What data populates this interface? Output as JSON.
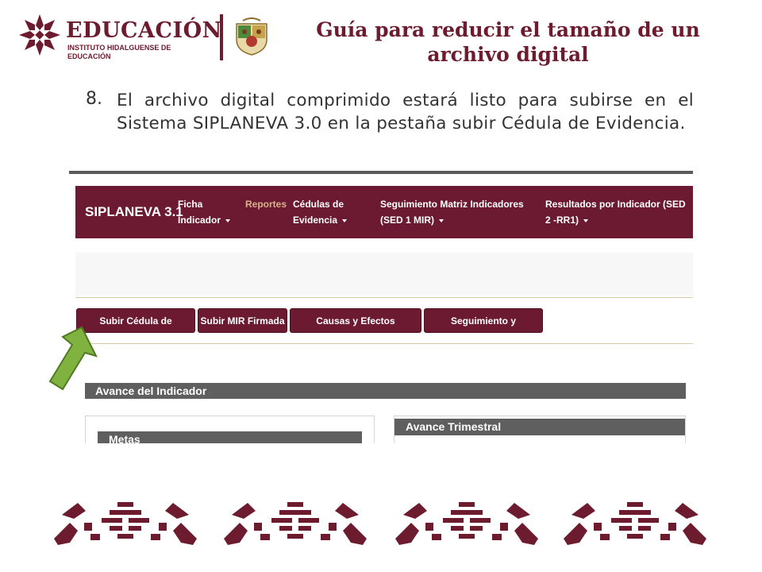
{
  "header": {
    "logo_word": "EDUCACIÓN",
    "logo_subtitle_line1": "INSTITUTO HIDALGUENSE DE",
    "logo_subtitle_line2": "EDUCACIÓN",
    "title_line1": "Guía para reducir el tamaño de un",
    "title_line2": "archivo digital"
  },
  "step": {
    "number": "8.",
    "text": "El archivo digital comprimido estará listo para subirse en el Sistema SIPLANEVA 3.0 en la pestaña subir Cédula de Evidencia."
  },
  "app": {
    "brand": "SIPLANEVA 3.1",
    "nav": [
      {
        "line1": "Ficha",
        "line2": "Indicador"
      },
      {
        "line1": "Reportes",
        "line2": ""
      },
      {
        "line1": "Cédulas de",
        "line2": "Evidencia"
      },
      {
        "line1": "Seguimiento Matriz Indicadores",
        "line2": "(SED 1 MIR)"
      },
      {
        "line1": "Resultados por Indicador (SED",
        "line2": "2 -RR1)"
      }
    ],
    "tabs": [
      "Subir Cédula de Evidencia",
      "Subir MIR Firmada",
      "Causas y Efectos reportados",
      "Seguimiento y Evaluación"
    ],
    "section_avance": "Avance del Indicador",
    "section_metas": "Metas",
    "section_trimestral": "Avance Trimestral"
  },
  "colors": {
    "brand": "#6d1b2e",
    "nav_bg": "#6b1a32",
    "arrow": "#7fb23f",
    "section_bar": "#5f5f5f"
  }
}
